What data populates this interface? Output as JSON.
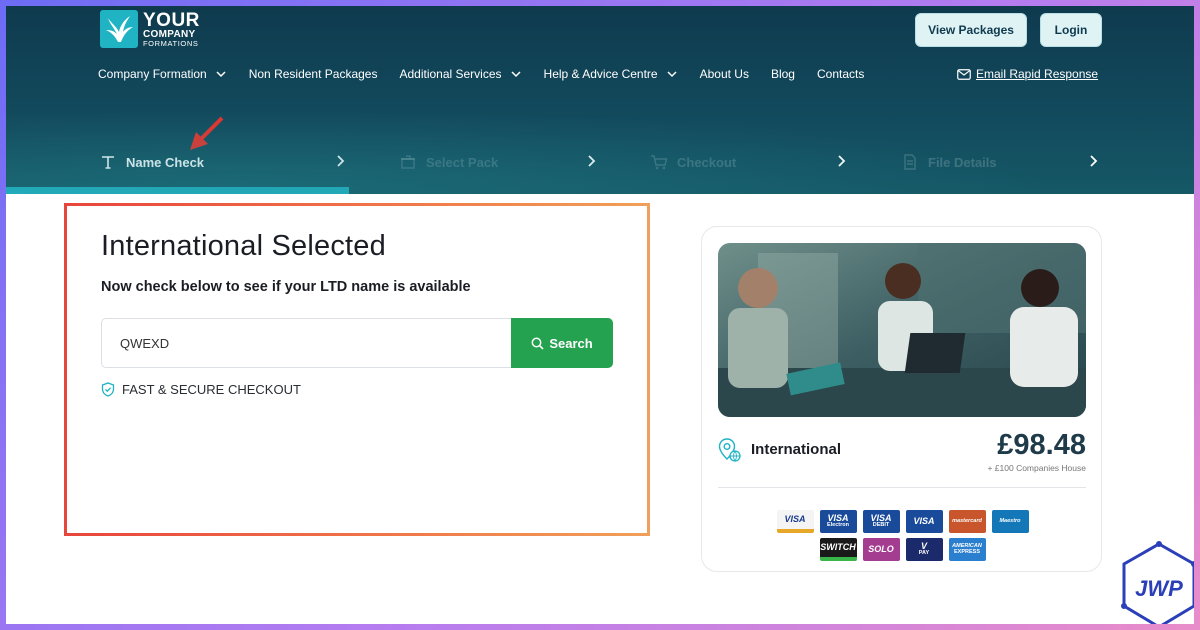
{
  "header": {
    "logo": {
      "line1": "YOUR",
      "line2": "COMPANY",
      "line3": "FORMATIONS"
    },
    "buttons": {
      "view_packages": "View Packages",
      "login": "Login"
    },
    "nav": [
      {
        "label": "Company Formation",
        "dropdown": true
      },
      {
        "label": "Non Resident Packages",
        "dropdown": false
      },
      {
        "label": "Additional Services",
        "dropdown": true
      },
      {
        "label": "Help & Advice Centre",
        "dropdown": true
      },
      {
        "label": "About Us",
        "dropdown": false
      },
      {
        "label": "Blog",
        "dropdown": false
      },
      {
        "label": "Contacts",
        "dropdown": false
      }
    ],
    "email_link": "Email Rapid Response"
  },
  "steps": [
    {
      "label": "Name Check",
      "icon": "text-icon",
      "active": true
    },
    {
      "label": "Select Pack",
      "icon": "package-icon",
      "active": false
    },
    {
      "label": "Checkout",
      "icon": "cart-icon",
      "active": false
    },
    {
      "label": "File Details",
      "icon": "file-icon",
      "active": false
    }
  ],
  "name_check": {
    "title": "International Selected",
    "subtitle": "Now check below to see if your LTD name is available",
    "input_value": "QWEXD",
    "search_label": "Search",
    "secure_text": "FAST & SECURE CHECKOUT"
  },
  "package_card": {
    "name": "International",
    "price": "£98.48",
    "price_note": "+ £100 Companies House",
    "payment_cards": [
      {
        "name": "VISA",
        "sub": "",
        "color": "#f4f4f4",
        "text_color": "#1a3a8f",
        "stripe": "#e7a82a"
      },
      {
        "name": "VISA",
        "sub": "Electron",
        "color": "#1a4b9b",
        "text_color": "#ffffff",
        "stripe": ""
      },
      {
        "name": "VISA",
        "sub": "DEBIT",
        "color": "#1a4b9b",
        "text_color": "#ffffff",
        "stripe": ""
      },
      {
        "name": "VISA",
        "sub": "",
        "color": "#1a4b9b",
        "text_color": "#ffffff",
        "stripe": ""
      },
      {
        "name": "mastercard",
        "sub": "",
        "color": "#c8552b",
        "text_color": "#ffffff",
        "stripe": ""
      },
      {
        "name": "Maestro",
        "sub": "",
        "color": "#1478b8",
        "text_color": "#ffffff",
        "stripe": ""
      }
    ],
    "payment_cards_row2": [
      {
        "name": "SWITCH",
        "sub": "",
        "color": "#1a1a1a",
        "text_color": "#ffffff",
        "stripe": "#39b54a"
      },
      {
        "name": "SOLO",
        "sub": "",
        "color": "#a43c8f",
        "text_color": "#ffffff",
        "stripe": ""
      },
      {
        "name": "V",
        "sub": "PAY",
        "color": "#1a2a6b",
        "text_color": "#ffffff",
        "stripe": ""
      },
      {
        "name": "AMERICAN",
        "sub": "EXPRESS",
        "color": "#2b7fcf",
        "text_color": "#ffffff",
        "stripe": ""
      }
    ]
  },
  "watermark": {
    "text": "JWP"
  },
  "colors": {
    "teal": "#1fb3c4",
    "green": "#25a24f",
    "navy": "#0f3a4e"
  }
}
